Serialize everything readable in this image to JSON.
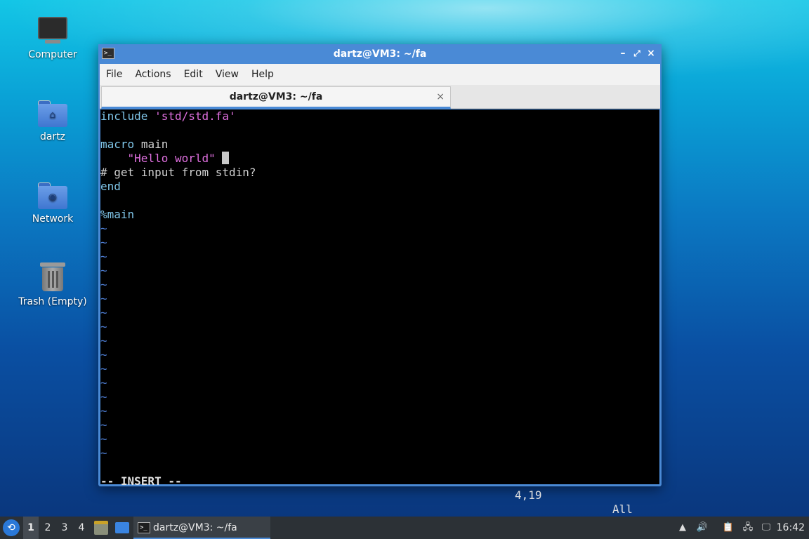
{
  "desktop": {
    "icons": [
      {
        "label": "Computer"
      },
      {
        "label": "dartz"
      },
      {
        "label": "Network"
      },
      {
        "label": "Trash (Empty)"
      }
    ]
  },
  "window": {
    "title": "dartz@VM3: ~/fa",
    "icon_glyph": ">_",
    "controls": {
      "minimize": "–",
      "maximize": "⤢",
      "close": "×"
    },
    "menu": [
      "File",
      "Actions",
      "Edit",
      "View",
      "Help"
    ],
    "tab": {
      "label": "dartz@VM3: ~/fa",
      "close": "×"
    }
  },
  "editor": {
    "line1_kw": "include",
    "line1_str": "'std/std.fa'",
    "line3_kw": "macro",
    "line3_rest": "main",
    "line4_str": "\"Hello world\"",
    "line5": "# get input from stdin?",
    "line6_kw": "end",
    "line8_kw": "%main",
    "tilde": "~",
    "status_mode": "-- INSERT --",
    "status_pos": "4,19",
    "status_pct": "All"
  },
  "taskbar": {
    "start_glyph": "⟲",
    "workspaces": [
      "1",
      "2",
      "3",
      "4"
    ],
    "active_workspace": "1",
    "task_label": "dartz@VM3: ~/fa",
    "task_icon": ">_",
    "tray_icons": [
      "arrow-up-icon",
      "volume-icon",
      "clipboard-icon",
      "network-icon",
      "notification-icon"
    ],
    "clock": "16:42"
  },
  "colors": {
    "accent": "#4a8ad6",
    "keyword": "#7fc5e8",
    "string": "#e070e0",
    "tilde": "#4f7fd6"
  }
}
